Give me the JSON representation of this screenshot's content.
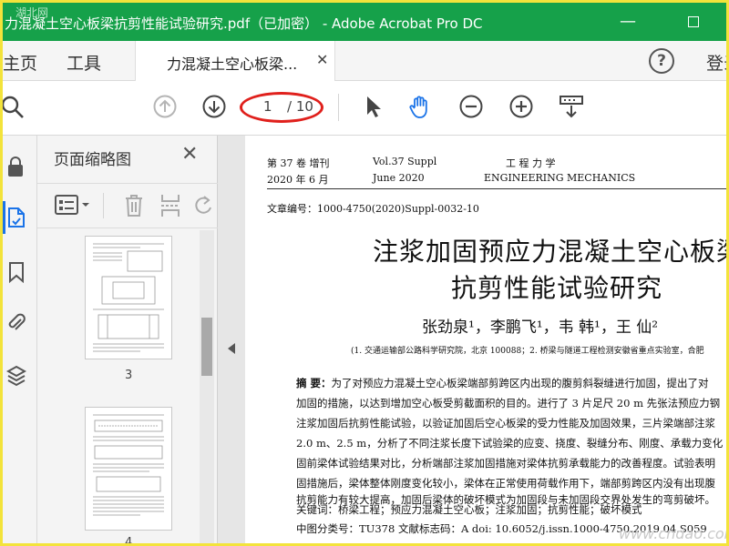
{
  "window": {
    "title": "力混凝土空心板梁抗剪性能试验研究.pdf（已加密） - Adobe Acrobat Pro DC",
    "watermark_top": "湖北网",
    "watermark_bottom": "www.cndao.com"
  },
  "menubar": {
    "home": "主页",
    "tools": "工具",
    "doc_tab": "力混凝土空心板梁...",
    "login": "登录"
  },
  "toolbar": {
    "current_page": "1",
    "total_pages": "/ 10",
    "icons": [
      "page-up-icon",
      "page-down-icon",
      "select-pointer-icon",
      "hand-tool-icon",
      "zoom-out-icon",
      "zoom-in-icon",
      "scroll-mode-icon"
    ]
  },
  "left_rail": {
    "icons": [
      "lock-icon",
      "page-thumbnails-icon",
      "bookmark-icon",
      "attachment-icon",
      "layers-icon"
    ]
  },
  "thumbnails_panel": {
    "title": "页面缩略图",
    "pages": [
      {
        "label": "3"
      },
      {
        "label": "4"
      }
    ]
  },
  "document": {
    "header_left1": "第 37 卷 增刊",
    "header_left2": "2020 年  6 月",
    "header_mid1": "Vol.37  Suppl",
    "header_mid2": "June    2020",
    "header_right1": "工    程    力    学",
    "header_right2": "ENGINEERING    MECHANICS",
    "article_no": "文章编号：1000-4750(2020)Suppl-0032-10",
    "title_line1": "注浆加固预应力混凝土空心板梁",
    "title_line2": "抗剪性能试验研究",
    "authors": "张劲泉¹，李鹏飞¹，韦    韩¹，王    仙²",
    "affiliation": "(1. 交通运输部公路科学研究院，北京  100088；2. 桥梁与隧道工程检测安徽省重点实验室，合肥",
    "abstract_label": "摘    要：",
    "abstract_lines": [
      "为了对预应力混凝土空心板梁端部剪跨区内出现的腹剪斜裂缝进行加固，提出了对",
      "加固的措施，以达到增加空心板受剪截面积的目的。进行了 3 片足尺 20 m 先张法预应力钢",
      "注浆加固后抗剪性能试验，以验证加固后空心板梁的受力性能及加固效果，三片梁端部注浆",
      "2.0 m、2.5 m，分析了不同注浆长度下试验梁的应变、挠度、裂缝分布、刚度、承载力变化",
      "固前梁体试验结果对比，分析端部注浆加固措施对梁体抗剪承载能力的改善程度。试验表明",
      "固措施后，梁体整体刚度变化较小，梁体在正常使用荷载作用下，端部剪跨区内没有出现腹",
      "抗剪能力有较大提高，加固后梁体的破坏模式为加固段与未加固段交界处发生的弯剪破坏。"
    ],
    "keywords": "关键词：桥梁工程；预应力混凝土空心板；注浆加固；抗剪性能；破坏模式",
    "classification": "中图分类号：TU378          文献标志码：A          doi: 10.6052/j.issn.1000-4750.2019.04.S059"
  }
}
